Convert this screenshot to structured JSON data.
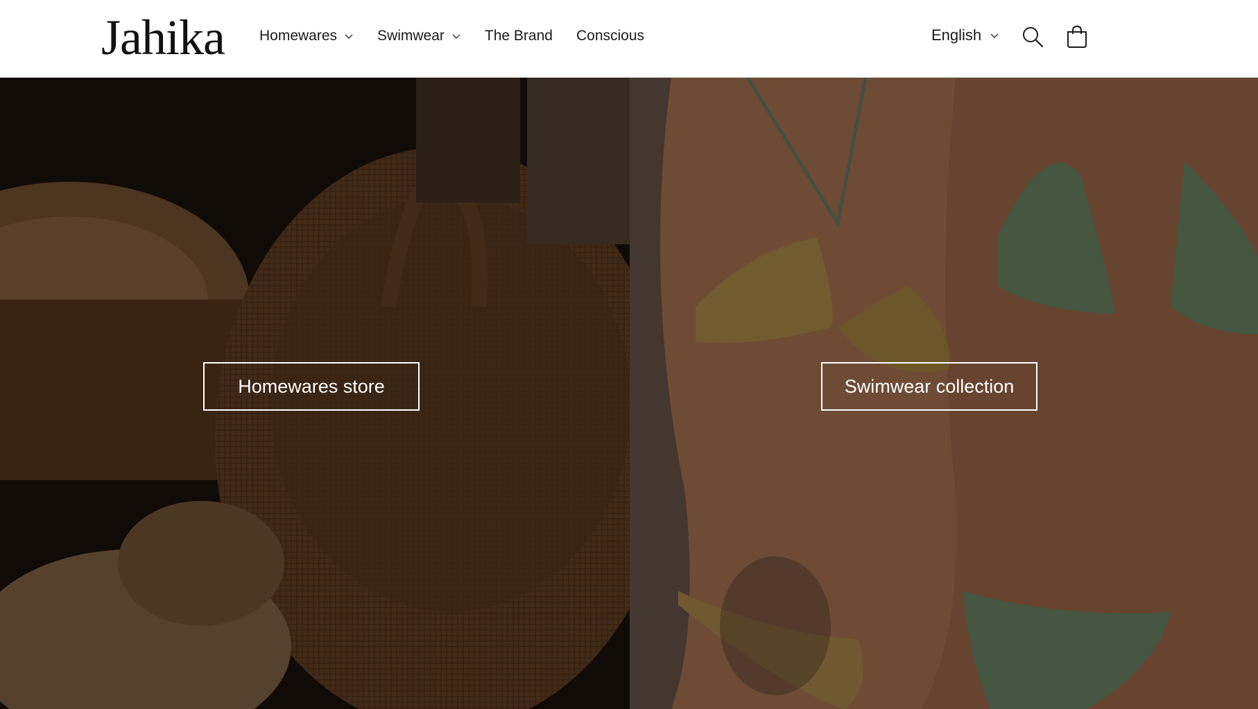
{
  "brand": {
    "logo_text": "Jahika"
  },
  "nav": {
    "items": [
      {
        "label": "Homewares",
        "has_dropdown": true
      },
      {
        "label": "Swimwear",
        "has_dropdown": true
      },
      {
        "label": "The Brand",
        "has_dropdown": false
      },
      {
        "label": "Conscious",
        "has_dropdown": false
      }
    ]
  },
  "header_tools": {
    "language": "English",
    "search_icon": "search-icon",
    "cart_icon": "shopping-bag-icon"
  },
  "hero": {
    "left_cta": "Homewares store",
    "right_cta": "Swimwear collection"
  },
  "colors": {
    "header_bg": "#ffffff",
    "text": "#121212",
    "cta_border": "#ffffff"
  }
}
